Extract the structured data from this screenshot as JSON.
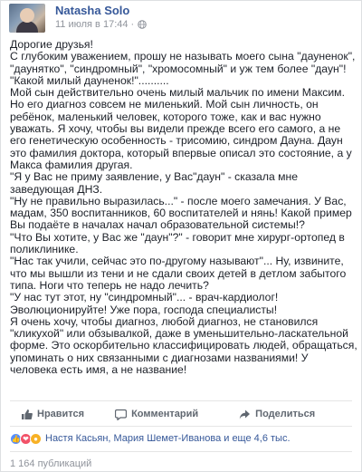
{
  "post": {
    "author": "Natasha Solo",
    "timestamp": "11 июля в 17:44 ·",
    "paragraphs": [
      "Дорогие друзья!",
      "С глубоким уважением, прошу не называть моего сына \"дауненок\", \"даунятко\", \"синдромный\", \"хромосомный\" и уж тем более \"даун\"! \"Какой милый дауненок!\"..........",
      "Мой сын действительно очень милый мальчик по имени Максим. Но его диагноз совсем не миленький. Мой сын личность, он ребёнок, маленький человек, которого тоже, как и вас нужно уважать. Я хочу, чтобы вы видели прежде всего его самого, а не его генетическую особенность - трисомию, синдром Дауна. Даун это фамилия доктора, который впервые описал это состояние, а у Макса фамилия другая.",
      "\"Я у Вас не приму заявление, у Вас\"даун\" - сказала мне заведующая ДНЗ.",
      "\"Ну не правильно выразилась...\" - после моего замечания. У Вас, мадам, 350 воспитанников, 60 воспитателей и нянь! Какой пример Вы подаёте в началах начал образовательной системы!?",
      "\"Что Вы хотите, у Вас же \"даун\"?\" - говорит мне хирург-ортопед в поликлинике.",
      "\"Нас так учили, сейчас это по-другому называют\"... Ну, извините, что мы вышли из тени и не сдали своих детей в детлом забытого типа. Ноги что теперь не надо лечить?",
      "\"У нас тут этот, ну \"синдромный\"... - врач-кардиолог! Эволюционируйте! Уже пора, господа специалисты!",
      "Я очень хочу, чтобы диагноз, любой диагноз, не становился \"кликухой\" или обзывалкой, даже в уменьшительно-ласкательной форме. Это оскорбительно классифицировать людей, обращаться, упоминать о них связанными с диагнозами названиями! У человека есть имя, а не название!"
    ]
  },
  "actions": {
    "like": "Нравится",
    "comment": "Комментарий",
    "share": "Поделиться"
  },
  "reactions": {
    "names": "Настя Касьян, Мария Шемет-Иванова и еще 4,6 тыс."
  },
  "publications": "1 164 публикаций",
  "colors": {
    "link": "#365899",
    "text": "#1d2129",
    "muted": "#90949c"
  }
}
